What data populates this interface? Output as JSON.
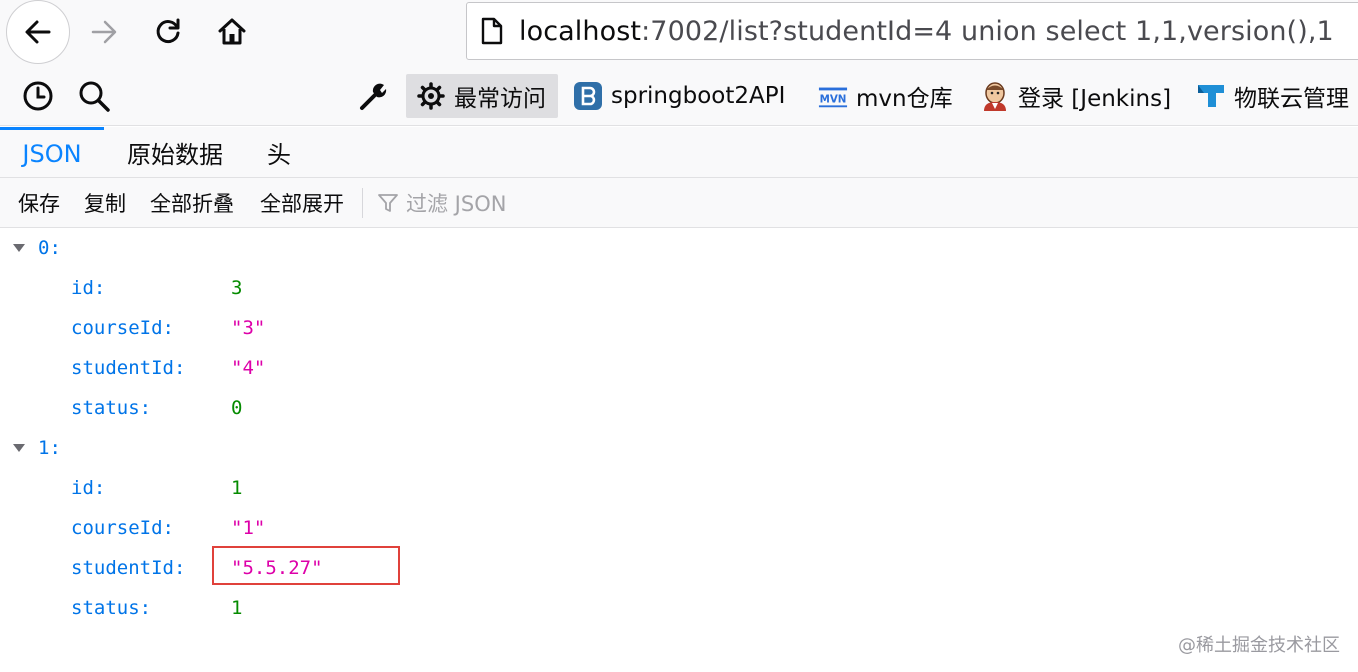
{
  "nav": {
    "back_icon": "back-arrow-icon",
    "forward_icon": "forward-arrow-icon",
    "reload_icon": "reload-icon",
    "home_icon": "home-icon",
    "url_host": "localhost",
    "url_rest": ":7002/list?studentId=4 union select 1,1,version(),1"
  },
  "toolbar": {
    "history_icon": "clock-icon",
    "search_icon": "search-icon",
    "tools_icon": "wrench-icon",
    "bookmarks": [
      {
        "label": "最常访问",
        "icon": "gear-icon"
      },
      {
        "label": "springboot2API",
        "icon": "bootstrap-icon"
      },
      {
        "label": "mvn仓库",
        "icon": "mvn-icon"
      },
      {
        "label": "登录 [Jenkins]",
        "icon": "jenkins-icon"
      },
      {
        "label": "物联云管理",
        "icon": "cloud-icon"
      }
    ]
  },
  "tabs": [
    {
      "label": "JSON",
      "active": true
    },
    {
      "label": "原始数据",
      "active": false
    },
    {
      "label": "头",
      "active": false
    }
  ],
  "actions": {
    "save": "保存",
    "copy": "复制",
    "collapse_all": "全部折叠",
    "expand_all": "全部展开",
    "filter_placeholder": "过滤 JSON"
  },
  "json": {
    "items": [
      {
        "index": "0:",
        "fields": [
          {
            "key": "id:",
            "value": "3",
            "type": "number"
          },
          {
            "key": "courseId:",
            "value": "\"3\"",
            "type": "string"
          },
          {
            "key": "studentId:",
            "value": "\"4\"",
            "type": "string"
          },
          {
            "key": "status:",
            "value": "0",
            "type": "number"
          }
        ]
      },
      {
        "index": "1:",
        "fields": [
          {
            "key": "id:",
            "value": "1",
            "type": "number"
          },
          {
            "key": "courseId:",
            "value": "\"1\"",
            "type": "string"
          },
          {
            "key": "studentId:",
            "value": "\"5.5.27\"",
            "type": "string"
          },
          {
            "key": "status:",
            "value": "1",
            "type": "number"
          }
        ]
      }
    ]
  },
  "watermark": "@稀土掘金技术社区",
  "colors": {
    "accent": "#0a84ff",
    "key": "#0074e8",
    "number": "#058b00",
    "string": "#dd00a9",
    "highlight": "#e0413b"
  }
}
